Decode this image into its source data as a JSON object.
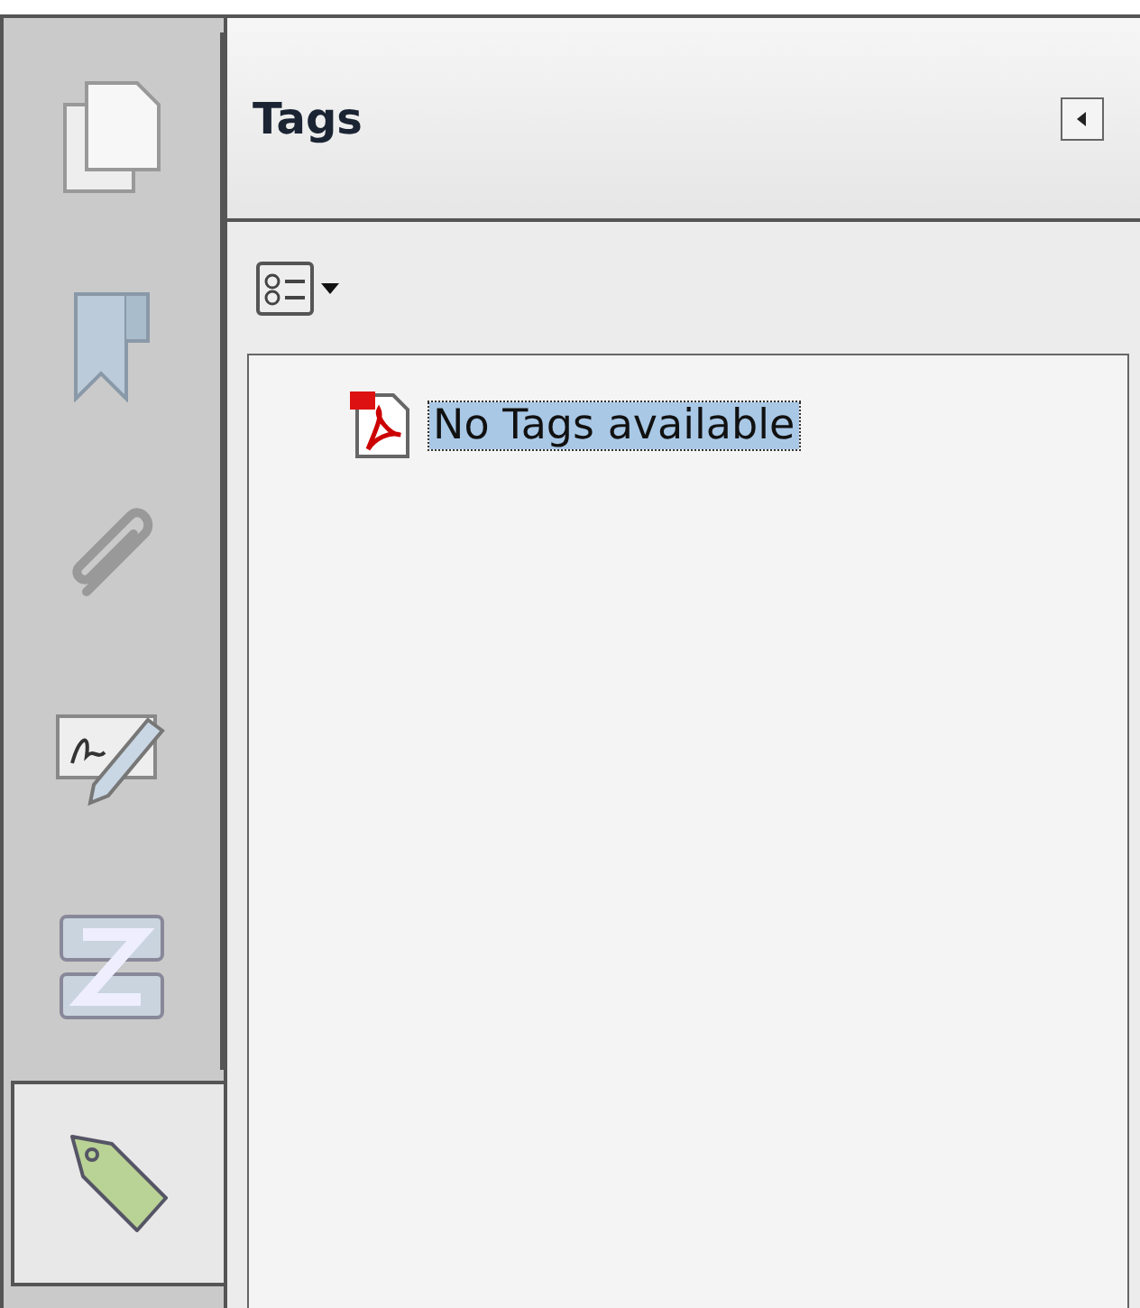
{
  "side_tabs": [
    {
      "kind": "pages",
      "selected": false
    },
    {
      "kind": "bookmarks",
      "selected": false
    },
    {
      "kind": "attachments",
      "selected": false
    },
    {
      "kind": "signatures",
      "selected": false
    },
    {
      "kind": "layers",
      "selected": false
    },
    {
      "kind": "tags",
      "selected": true
    }
  ],
  "panel": {
    "title": "Tags"
  },
  "tree": {
    "items": [
      {
        "label": "No Tags available",
        "selected": true
      }
    ]
  }
}
